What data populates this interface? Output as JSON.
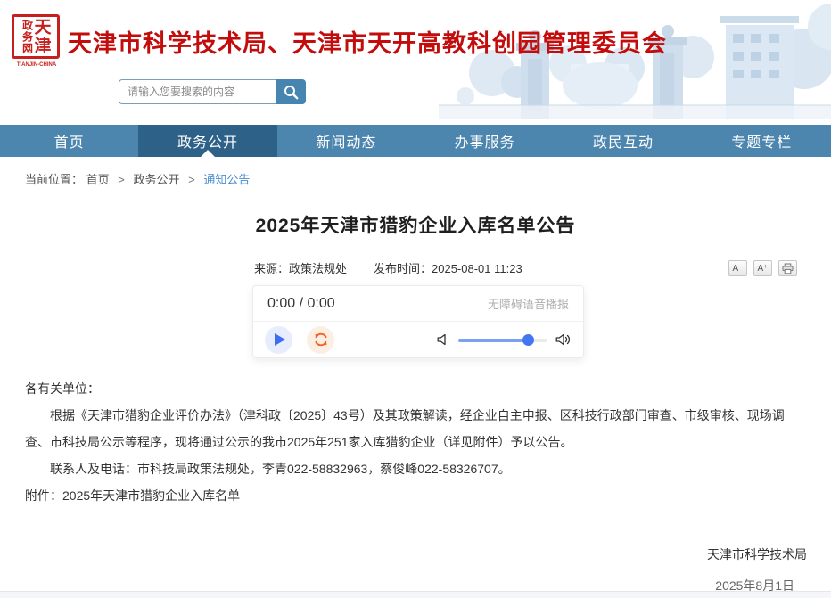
{
  "header": {
    "logo": {
      "seal_right_column": "天津",
      "seal_left_column": "政务网",
      "caption": "TIANJIN-CHINA"
    },
    "title": "天津市科学技术局、天津市天开高教科创园管理委员会",
    "search": {
      "placeholder": "请输入您要搜索的内容"
    }
  },
  "nav": {
    "items": [
      {
        "label": "首页",
        "active": false
      },
      {
        "label": "政务公开",
        "active": true
      },
      {
        "label": "新闻动态",
        "active": false
      },
      {
        "label": "办事服务",
        "active": false
      },
      {
        "label": "政民互动",
        "active": false
      },
      {
        "label": "专题专栏",
        "active": false
      }
    ]
  },
  "breadcrumb": {
    "label": "当前位置：",
    "separator": ">",
    "items": [
      "首页",
      "政务公开",
      "通知公告"
    ]
  },
  "article": {
    "title": "2025年天津市猎豹企业入库名单公告",
    "meta": {
      "source": "来源：政策法规处",
      "publish_time": "发布时间：2025-08-01 11:23"
    },
    "tools": {
      "font_smaller": "A⁻",
      "font_larger": "A⁺"
    },
    "player": {
      "time_display": "0:00 / 0:00",
      "caption": "无障碍语音播报",
      "volume_percent": 78
    },
    "paragraphs": [
      "各有关单位：",
      "　　根据《天津市猎豹企业评价办法》（津科政〔2025〕43号）及其政策解读，经企业自主申报、区科技行政部门审查、市级审核、现场调查、市科技局公示等程序，现将通过公示的我市2025年251家入库猎豹企业（详见附件）予以公告。",
      "　　联系人及电话：市科技局政策法规处，李青022-58832963，蔡俊峰022-58326707。"
    ],
    "attachment": {
      "label": "附件：",
      "name": "2025年天津市猎豹企业入库名单"
    },
    "signature": "天津市科学技术局",
    "date": "2025年8月1日"
  },
  "colors": {
    "accent_red": "#c30d0d",
    "nav_blue": "#4c86ae",
    "nav_active_blue": "#2d6187",
    "breadcrumb_link_blue": "#4a8fd4",
    "play_blue": "#3b6ef0",
    "refresh_orange": "#f3601f",
    "slider_blue": "#4576f2"
  }
}
